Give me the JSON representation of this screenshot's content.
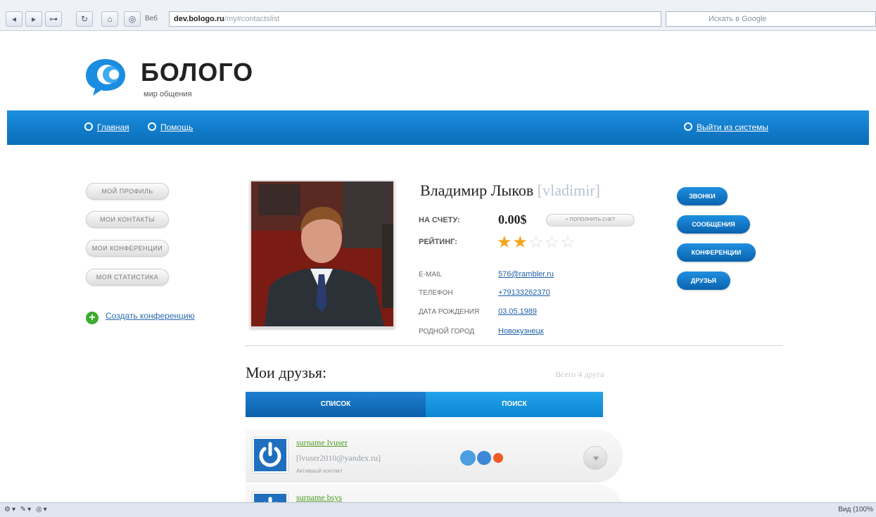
{
  "browser": {
    "page_tag": "Веб",
    "url_host": "dev.bologo.ru",
    "url_path": "/my#contactslist",
    "search_placeholder": "Искать в Google",
    "status_zoom": "Вид (100%"
  },
  "brand": {
    "title": "БОЛОГО",
    "subtitle": "мир общения",
    "color": "#1a8de0"
  },
  "nav": {
    "home": "Главная",
    "help": "Помощь",
    "logout": "Выйти из системы"
  },
  "menu": {
    "profile": "МОЙ ПРОФИЛЬ",
    "contacts": "МОИ КОНТАКТЫ",
    "conferences": "МОИ КОНФЕРЕНЦИИ",
    "statistics": "МОЯ СТАТИСТИКА",
    "create_conference": "Создать конференцию"
  },
  "profile": {
    "name": "Владимир Лыков",
    "login": "[vladimir]",
    "balance_label": "НА СЧЕТУ:",
    "balance": "0.00$",
    "topup": "+ ПОПОЛНИТЬ СЧЕТ",
    "rating_label": "РЕЙТИНГ:",
    "rating": 2,
    "rating_max": 5,
    "fields": {
      "email_label": "E-MAIL",
      "email": "576@rambler.ru",
      "phone_label": "ТЕЛЕФОН",
      "phone": "+79133262370",
      "birth_label": "ДАТА РОЖДЕНИЯ",
      "birth": "03.05.1989",
      "city_label": "РОДНОЙ ГОРОД",
      "city": "Новокузнецк"
    }
  },
  "actions": {
    "calls": "ЗВОНКИ",
    "messages": "СООБЩЕНИЯ",
    "conferences": "КОНФЕРЕНЦИИ",
    "friends": "ДРУЗЬЯ"
  },
  "friends": {
    "title": "Мои друзья:",
    "count": "Всего 4 друга",
    "tab_list": "СПИСОК",
    "tab_search": "ПОИСК",
    "items": [
      {
        "name": "surname lvuser",
        "email": "[lvuser2010@yandex.ru]",
        "status": "Активный контакт"
      },
      {
        "name": "surname bsys",
        "email": "",
        "status": ""
      }
    ]
  }
}
